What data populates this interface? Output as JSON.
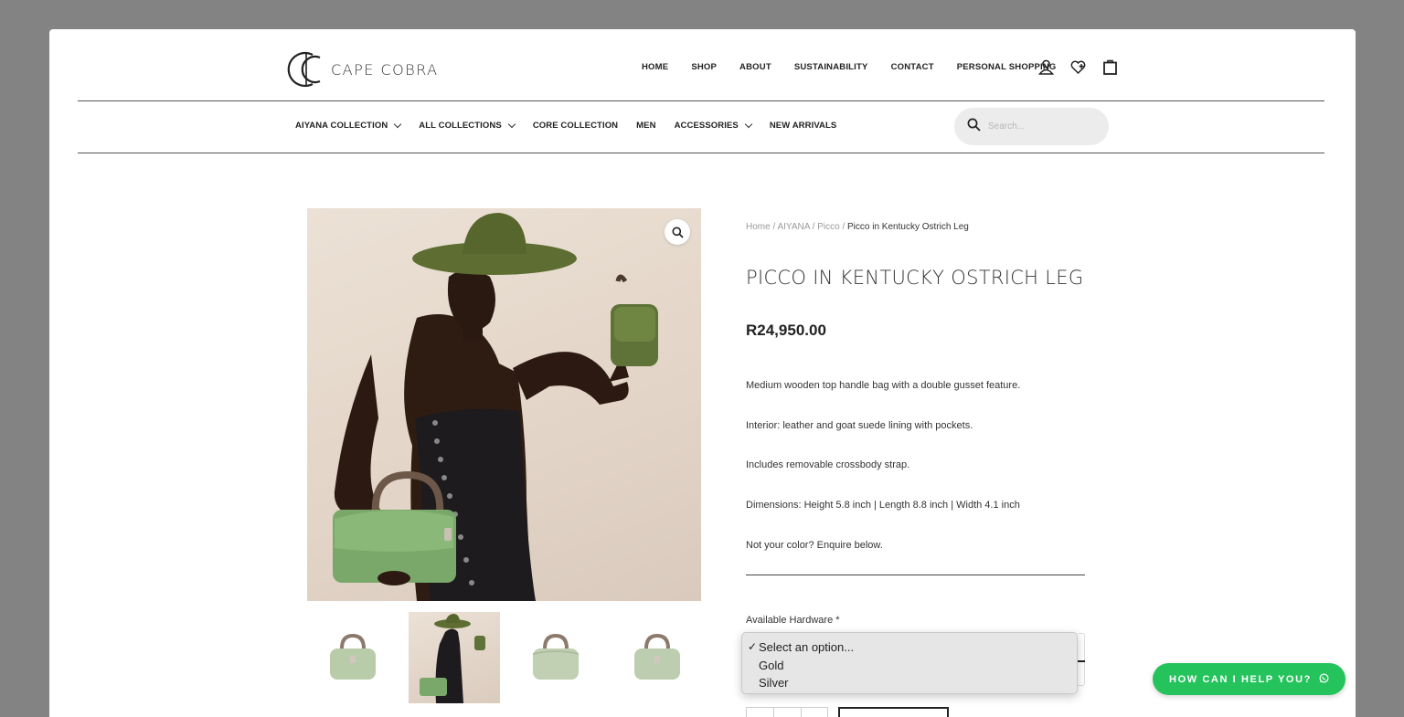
{
  "brand": {
    "name": "CAPE COBRA"
  },
  "header": {
    "nav": [
      "HOME",
      "SHOP",
      "ABOUT",
      "SUSTAINABILITY",
      "CONTACT",
      "PERSONAL SHOPPING"
    ],
    "icons": [
      "user-icon",
      "wishlist-heart-icon",
      "shopping-bag-icon"
    ]
  },
  "subnav": {
    "items": [
      {
        "label": "AIYANA COLLECTION",
        "dropdown": true
      },
      {
        "label": "ALL COLLECTIONS",
        "dropdown": true
      },
      {
        "label": "CORE COLLECTION",
        "dropdown": false
      },
      {
        "label": "MEN",
        "dropdown": false
      },
      {
        "label": "ACCESSORIES",
        "dropdown": true
      },
      {
        "label": "NEW ARRIVALS",
        "dropdown": false
      }
    ],
    "search_placeholder": "Search..."
  },
  "breadcrumb": {
    "home": "Home",
    "sep": "/",
    "collection": "AIYANA",
    "category": "Picco",
    "current": "Picco in Kentucky Ostrich Leg"
  },
  "product": {
    "title": "PICCO IN KENTUCKY OSTRICH LEG",
    "price": "R24,950.00",
    "description": [
      "Medium wooden top handle bag with a double gusset feature.",
      "Interior: leather and goat suede lining with pockets.",
      "Includes removable crossbody strap.",
      "Dimensions: Height 5.8 inch | Length 8.8 inch | Width 4.1 inch",
      "Not your color? Enquire below."
    ],
    "hardware_label": "Available Hardware",
    "required_mark": "*",
    "hardware_options": [
      "Select an option...",
      "Gold",
      "Silver"
    ],
    "selected_option": "Select an option...",
    "thumbnail_count": 4,
    "active_thumbnail": 2
  },
  "help_button": {
    "label": "HOW CAN I HELP YOU?"
  },
  "colors": {
    "accent_green": "#25c35c",
    "bag_green": "#7aa86a",
    "hat_green": "#5e6e32"
  }
}
